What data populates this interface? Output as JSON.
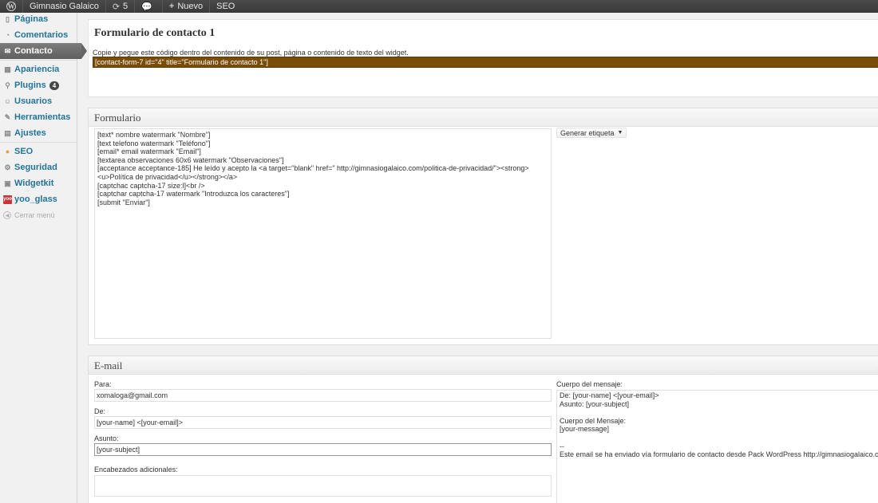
{
  "adminbar": {
    "site_name": "Gimnasio Galaico",
    "updates_count": "5",
    "new_label": "Nuevo",
    "seo_label": "SEO"
  },
  "sidebar": {
    "items": [
      {
        "label": "Páginas",
        "icon": "pages-icon"
      },
      {
        "label": "Comentarios",
        "icon": "comments-icon"
      },
      {
        "label": "Contacto",
        "icon": "contact-icon",
        "active": true
      },
      {
        "label": "Apariencia",
        "icon": "appearance-icon"
      },
      {
        "label": "Plugins",
        "icon": "plugins-icon",
        "badge": "4"
      },
      {
        "label": "Usuarios",
        "icon": "users-icon"
      },
      {
        "label": "Herramientas",
        "icon": "tools-icon"
      },
      {
        "label": "Ajustes",
        "icon": "settings-icon"
      },
      {
        "label": "SEO",
        "icon": "seo-icon"
      },
      {
        "label": "Seguridad",
        "icon": "security-icon"
      },
      {
        "label": "Widgetkit",
        "icon": "widgetkit-icon"
      },
      {
        "label": "yoo_glass",
        "icon": "yoo-icon"
      }
    ],
    "collapse_label": "Cerrar menú"
  },
  "header": {
    "title": "Formulario de contacto 1",
    "instructions": "Copie y pegue este código dentro del contenido de su post, página o contenido de texto del widget.",
    "shortcode": "[contact-form-7 id=\"4\" title=\"Formulario de contacto 1\"]"
  },
  "form_section": {
    "title": "Formulario",
    "code": "[text* nombre watermark \"Nombre\"]\n[text telefono watermark \"Teléfono\"]\n[email* email watermark \"Email\"]\n[textarea observaciones 60x6 watermark \"Observaciones\"]\n[acceptance acceptance-185] He leído y acepto la <a target=\"blank\" href=\" http://gimnasiogalaico.com/politica-de-privacidad/\"><strong><u>Política de privacidad</u></strong></a>\n[captchac captcha-17 size:l]<br />\n[captchar captcha-17 watermark \"Introduzca los caracteres\"]\n[submit \"Enviar\"]",
    "generate_label": "Generar etiqueta"
  },
  "mail_section": {
    "title": "E-mail",
    "to_label": "Para:",
    "to_value": "xomaloga@gmail.com",
    "from_label": "De:",
    "from_value": "[your-name] <[your-email]>",
    "subject_label": "Asunto:",
    "subject_value": "[your-subject]",
    "headers_label": "Encabezados adicionales:",
    "body_label": "Cuerpo del mensaje:",
    "body_value": "De: [your-name] <[your-email]>\nAsunto: [your-subject]\n\nCuerpo del Mensaje:\n[your-message]\n\n--\nEste email se ha enviado vía formulario de contacto desde Pack WordPress http://gimnasiogalaico.com"
  }
}
